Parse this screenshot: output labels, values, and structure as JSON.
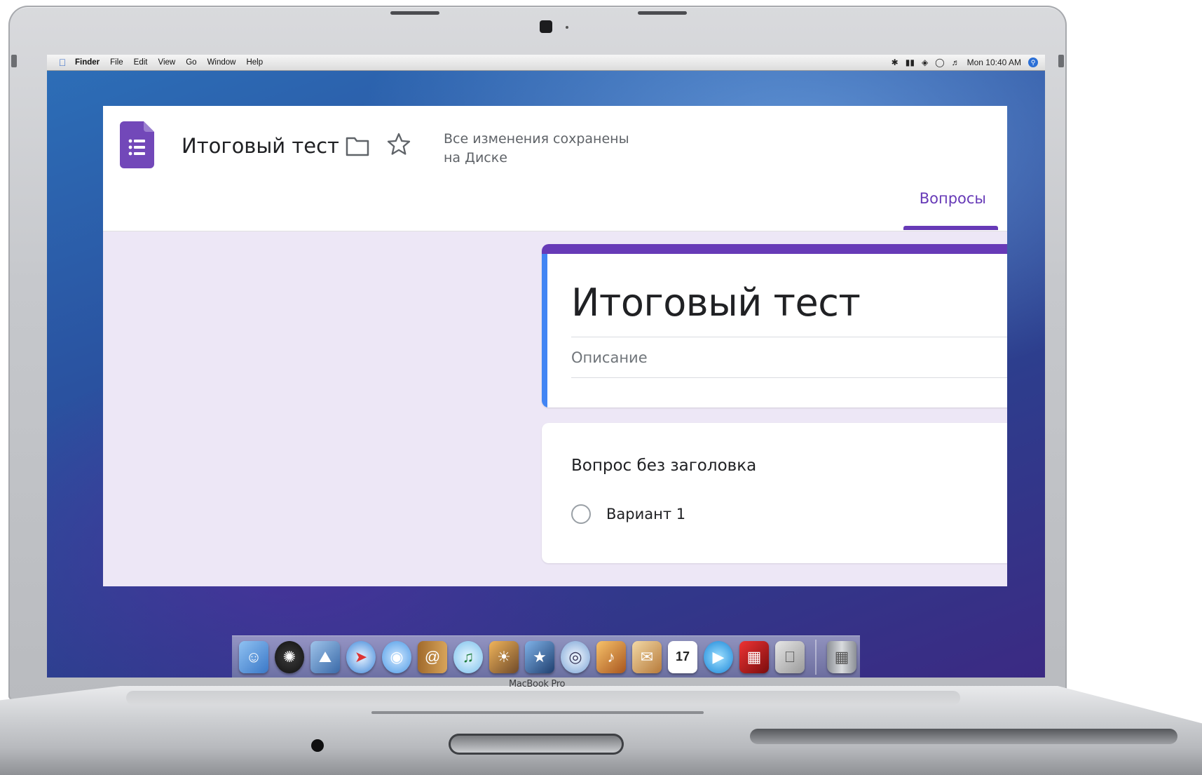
{
  "menubar": {
    "app": "Finder",
    "items": [
      "File",
      "Edit",
      "View",
      "Go",
      "Window",
      "Help"
    ],
    "clock": "Mon 10:40 AM"
  },
  "forms": {
    "doc_title": "Итоговый тест",
    "save_status_line1": "Все изменения сохранены",
    "save_status_line2": "на Диске",
    "tab_questions": "Вопросы",
    "form_title": "Итоговый тест",
    "description_placeholder": "Описание",
    "question_title": "Вопрос без заголовка",
    "option_1": "Вариант 1",
    "accent_color": "#673ab7",
    "focus_color": "#4285f4"
  },
  "dock": {
    "icons": [
      "finder-icon",
      "dashboard-icon",
      "preview-icon",
      "safari-icon",
      "ichat-icon",
      "address-book-icon",
      "itunes-icon",
      "iphoto-icon",
      "imovie-icon",
      "idvd-icon",
      "garageband-icon",
      "mail-icon",
      "ical-icon",
      "quicktime-icon",
      "photo-booth-icon",
      "system-preferences-icon",
      "trash-icon"
    ],
    "calendar_day": "17"
  },
  "device": {
    "brand": "MacBook Pro"
  }
}
